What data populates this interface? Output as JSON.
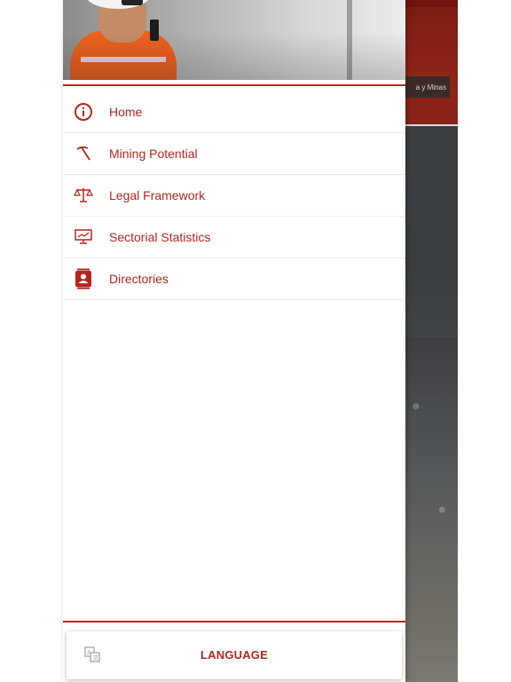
{
  "background_app": {
    "tag_text": "a y Minas"
  },
  "drawer": {
    "menu": [
      {
        "label": "Home",
        "icon": "info-icon"
      },
      {
        "label": "Mining Potential",
        "icon": "pickaxe-icon"
      },
      {
        "label": "Legal Framework",
        "icon": "scales-icon"
      },
      {
        "label": "Sectorial Statistics",
        "icon": "monitor-chart-icon"
      },
      {
        "label": "Directories",
        "icon": "contact-card-icon"
      }
    ],
    "footer": {
      "language_label": "LANGUAGE",
      "language_icon": "translate-icon"
    }
  },
  "colors": {
    "accent": "#b3261e",
    "divider": "#ececec",
    "surface": "#ffffff"
  }
}
